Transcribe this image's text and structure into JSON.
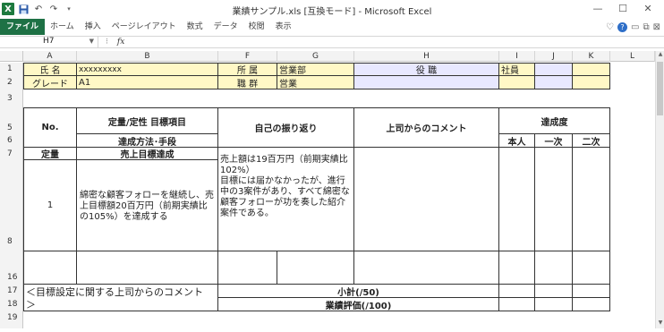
{
  "window": {
    "title": "業績サンプル.xls  [互換モード] - Microsoft Excel",
    "controls": [
      "—",
      "☐",
      "✕"
    ]
  },
  "ribbon": {
    "tabs": [
      "ファイル",
      "ホーム",
      "挿入",
      "ページレイアウト",
      "数式",
      "データ",
      "校閲",
      "表示"
    ]
  },
  "formula_bar": {
    "name_box": "H7",
    "fx": "fx",
    "value": ""
  },
  "columns": [
    "A",
    "B",
    "F",
    "G",
    "H",
    "I",
    "J",
    "K",
    "L"
  ],
  "rows": [
    "1",
    "2",
    "3",
    "5",
    "6",
    "7",
    "8",
    "16",
    "17",
    "18",
    "19"
  ],
  "sheet": {
    "r1": {
      "name_label": "氏  名",
      "name_value": "xxxxxxxxx",
      "dept_label": "所  属",
      "dept_value": "営業部",
      "role_label": "役  職",
      "role_value": "社員"
    },
    "r2": {
      "grade_label": "グレード",
      "grade_value": "A1",
      "job_label": "職  群",
      "job_value": "営業"
    },
    "hdr": {
      "no": "No.",
      "goal": "定量/定性  目標項目",
      "method": "達成方法･手段",
      "self": "自己の振り返り",
      "boss": "上司からのコメント",
      "achv": "達成度",
      "me": "本人",
      "first": "一次",
      "second": "二次"
    },
    "r7": {
      "type": "定量",
      "goal": "売上目標達成"
    },
    "r8": {
      "no": "1",
      "method": "綿密な顧客フォローを継続し、売上目標額20百万円（前期実績比の105%）を達成する",
      "self": "売上額は19百万円（前期実績比  102%）\n目標には届かなかったが、進行中の3案件があり、すべて綿密な顧客フォローが功を奏した紹介案件である。"
    },
    "r17": {
      "comment": "＜目標設定に関する上司からのコメント",
      "subtotal": "小計(/50)"
    },
    "r18": {
      "comment_close": "＞",
      "eval": "業績評価(/100)"
    }
  }
}
